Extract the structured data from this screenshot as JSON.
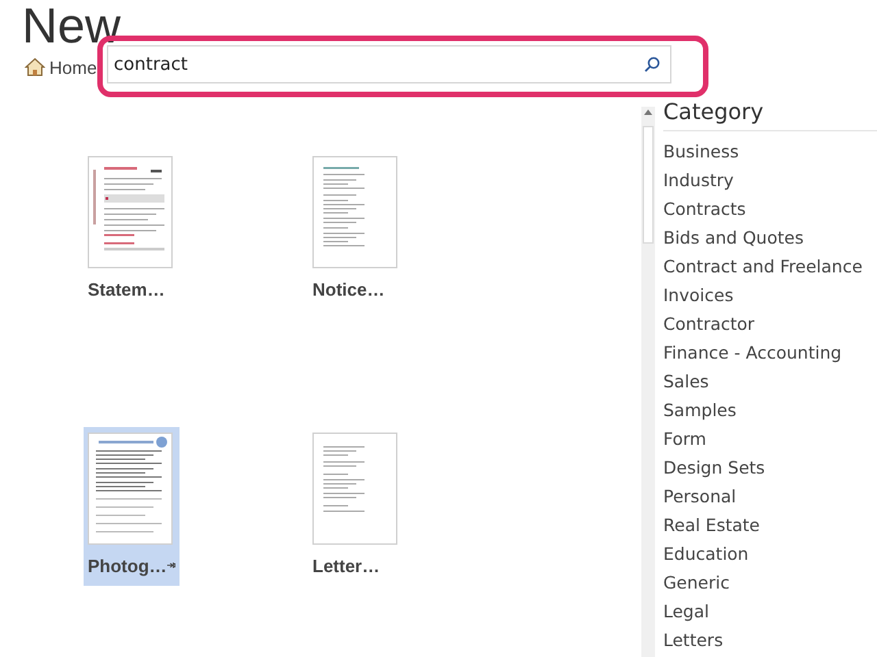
{
  "title": "New",
  "breadcrumb": {
    "label": "Home"
  },
  "search": {
    "value": "contract"
  },
  "templates": [
    {
      "label": "Statem…",
      "kind": "statement",
      "selected": false
    },
    {
      "label": "Notice…",
      "kind": "notice",
      "selected": false
    },
    {
      "label": "Photog…",
      "kind": "form",
      "selected": true
    },
    {
      "label": "Letter…",
      "kind": "letter",
      "selected": false
    }
  ],
  "category": {
    "heading": "Category",
    "items": [
      "Business",
      "Industry",
      "Contracts",
      "Bids and Quotes",
      "Contract and Freelance",
      "Invoices",
      "Contractor",
      "Finance - Accounting",
      "Sales",
      "Samples",
      "Form",
      "Design Sets",
      "Personal",
      "Real Estate",
      "Education",
      "Generic",
      "Legal",
      "Letters"
    ]
  }
}
